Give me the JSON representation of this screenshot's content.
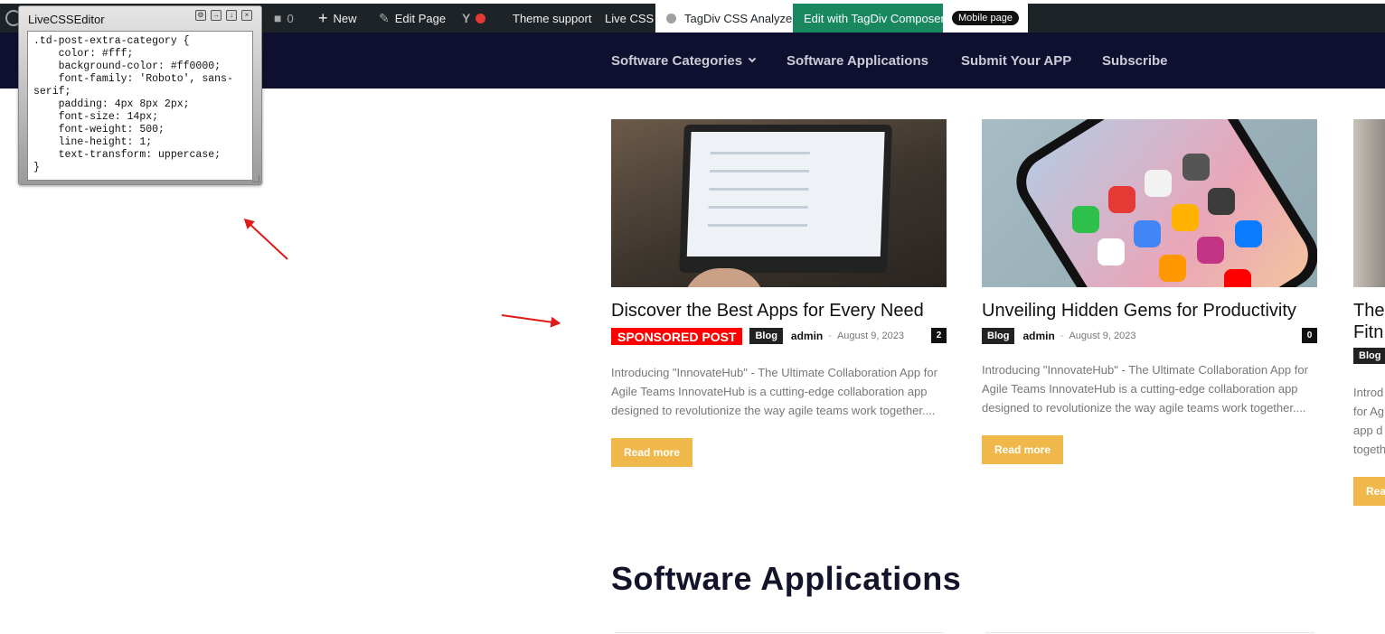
{
  "adminbar": {
    "comments_count": "0",
    "new_label": "New",
    "edit_page_label": "Edit Page",
    "theme_support_label": "Theme support",
    "live_css_label": "Live CSS",
    "css_analyzer_label": "TagDiv CSS Analyzer",
    "composer_label": "Edit with TagDiv Composer",
    "mobile_page_label": "Mobile page",
    "colors": {
      "bar": "#1d2327",
      "composer": "#19875f",
      "status_red": "#e53935",
      "status_gray": "#a0a0a0"
    }
  },
  "editor": {
    "title": "LiveCSSEditor",
    "code": ".td-post-extra-category {\n    color: #fff;\n    background-color: #ff0000;\n    font-family: 'Roboto', sans-serif;\n    padding: 4px 8px 2px;\n    font-size: 14px;\n    font-weight: 500;\n    line-height: 1;\n    text-transform: uppercase;\n}"
  },
  "nav": {
    "items": [
      {
        "label": "Software Categories"
      },
      {
        "label": "Software Applications"
      },
      {
        "label": "Submit Your APP"
      },
      {
        "label": "Subscribe"
      }
    ]
  },
  "posts": [
    {
      "title": "Discover the Best Apps for Every Need",
      "badge": "Sponsored Post",
      "category": "Blog",
      "author": "admin",
      "separator": "-",
      "date": "August 9, 2023",
      "comments": "2",
      "excerpt": "Introducing \"InnovateHub\" - The Ultimate Collaboration App for Agile Teams InnovateHub is a cutting-edge collaboration app designed to revolutionize the way agile teams work together....",
      "read_more": "Read more"
    },
    {
      "title": "Unveiling Hidden Gems for Productivity",
      "category": "Blog",
      "author": "admin",
      "separator": "-",
      "date": "August 9, 2023",
      "comments": "0",
      "excerpt": "Introducing \"InnovateHub\" - The Ultimate Collaboration App for Agile Teams InnovateHub is a cutting-edge collaboration app designed to revolutionize the way agile teams work together....",
      "read_more": "Read more"
    },
    {
      "title": "The",
      "title_line2": "Fitn",
      "category": "Blog",
      "excerpt_lines": [
        "Introd",
        "for Ag",
        "app d",
        "togeth"
      ],
      "read_more": "Rea"
    }
  ],
  "section": {
    "title": "Software Applications"
  },
  "theme_colors": {
    "header": "#0f1030",
    "read_more": "#f0b84a",
    "sponsored": "#ff0000",
    "annotation_arrow": "#e01919"
  }
}
